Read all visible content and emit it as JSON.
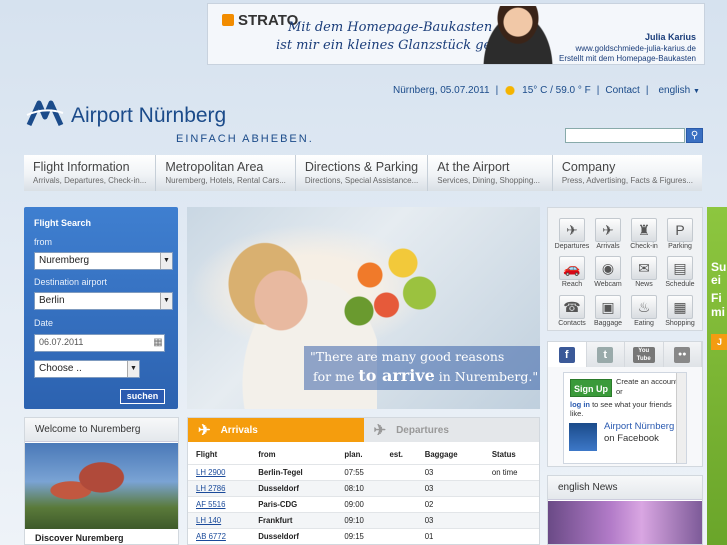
{
  "banner": {
    "brand": "STRATO",
    "slogan_line1": "Mit dem Homepage-Baukasten",
    "slogan_line2": "ist mir ein kleines Glanzstück gelungen.",
    "person_name": "Julia Karius",
    "url": "www.goldschmiede-julia-karius.de",
    "credit": "Erstellt mit dem Homepage-Baukasten"
  },
  "header": {
    "logo_text": "Airport Nürnberg",
    "tagline": "EINFACH ABHEBEN.",
    "location_date": "Nürnberg, 05.07.2011",
    "weather": "15° C / 59.0 ° F",
    "contact": "Contact",
    "language": "english",
    "separator": "|"
  },
  "nav": [
    {
      "title": "Flight Information",
      "sub": "Arrivals, Departures, Check-in..."
    },
    {
      "title": "Metropolitan Area",
      "sub": "Nuremberg, Hotels, Rental Cars..."
    },
    {
      "title": "Directions & Parking",
      "sub": "Directions, Special Assistance..."
    },
    {
      "title": "At the Airport",
      "sub": "Services, Dining, Shopping..."
    },
    {
      "title": "Company",
      "sub": "Press, Advertising, Facts & Figures..."
    }
  ],
  "flight_search": {
    "title": "Flight Search",
    "from_label": "from",
    "from_value": "Nuremberg",
    "dest_label": "Destination airport",
    "dest_value": "Berlin",
    "date_label": "Date",
    "date_value": "06.07.2011",
    "choose_value": "Choose ..",
    "submit": "suchen"
  },
  "hero": {
    "quote_line1": "\"There are many good reasons",
    "quote_line2_pre": "for me",
    "quote_line2_bold": "to arrive",
    "quote_line2_post": "in Nuremberg.\""
  },
  "quick_links": [
    {
      "label": "Departures",
      "icon": "plane-departure-icon",
      "glyph": "✈"
    },
    {
      "label": "Arrivals",
      "icon": "plane-arrival-icon",
      "glyph": "✈"
    },
    {
      "label": "Check-in",
      "icon": "check-in-icon",
      "glyph": "♜"
    },
    {
      "label": "Parking",
      "icon": "parking-icon",
      "glyph": "P"
    },
    {
      "label": "Reach",
      "icon": "car-icon",
      "glyph": "🚗"
    },
    {
      "label": "Webcam",
      "icon": "webcam-icon",
      "glyph": "◉"
    },
    {
      "label": "News",
      "icon": "news-icon",
      "glyph": "✉"
    },
    {
      "label": "Schedule",
      "icon": "schedule-icon",
      "glyph": "▤"
    },
    {
      "label": "Contacts",
      "icon": "phone-icon",
      "glyph": "☎"
    },
    {
      "label": "Baggage",
      "icon": "baggage-icon",
      "glyph": "▣"
    },
    {
      "label": "Eating",
      "icon": "dining-icon",
      "glyph": "♨"
    },
    {
      "label": "Shopping",
      "icon": "shopping-icon",
      "glyph": "▦"
    }
  ],
  "social": {
    "youtube_label": "You Tube",
    "signup": "Sign Up",
    "signup_text1": "Create an account or",
    "signup_link": "log in",
    "signup_text2": "to see what your friends like.",
    "page_name": "Airport Nürnberg",
    "page_suffix": "on Facebook"
  },
  "news": {
    "title": "english News"
  },
  "welcome": {
    "title": "Welcome to Nuremberg",
    "caption": "Discover Nuremberg"
  },
  "flights": {
    "tab_arrivals": "Arrivals",
    "tab_departures": "Departures",
    "headers": [
      "Flight",
      "from",
      "plan.",
      "est.",
      "Baggage",
      "Status"
    ],
    "rows": [
      [
        "LH 2900",
        "Berlin-Tegel",
        "07:55",
        "",
        "03",
        "on time"
      ],
      [
        "LH 2786",
        "Dusseldorf",
        "08:10",
        "",
        "03",
        ""
      ],
      [
        "AF 5516",
        "Paris-CDG",
        "09:00",
        "",
        "02",
        ""
      ],
      [
        "LH 140",
        "Frankfurt",
        "09:10",
        "",
        "03",
        ""
      ],
      [
        "AB 6772",
        "Dusseldorf",
        "09:15",
        "",
        "01",
        ""
      ]
    ]
  },
  "side_ad": {
    "line1": "Su",
    "line2": "ei",
    "line3": "Fi",
    "line4": "mi",
    "button": "J"
  },
  "colors": {
    "brand_blue": "#1b4b8a",
    "search_blue": "#2c62b0",
    "arrivals_orange": "#f59d0d"
  }
}
